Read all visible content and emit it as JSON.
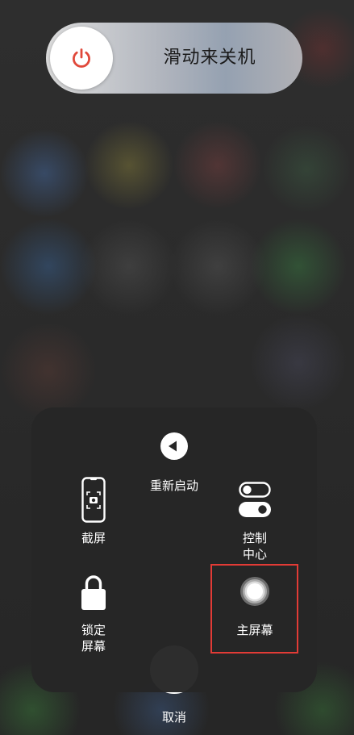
{
  "power_slider": {
    "label": "滑动来关机",
    "icon": "power-icon",
    "icon_color": "#e0483a"
  },
  "menu": {
    "restart": {
      "label": "重新启动",
      "icon": "left-arrow-circle-icon"
    },
    "screenshot": {
      "label": "截屏",
      "icon": "phone-screenshot-icon"
    },
    "control_center": {
      "label_line1": "控制",
      "label_line2": "中心",
      "icon": "toggles-icon"
    },
    "lock_screen": {
      "label_line1": "锁定",
      "label_line2": "屏幕",
      "icon": "lock-icon"
    },
    "home": {
      "label": "主屏幕",
      "icon": "home-button-icon"
    }
  },
  "cancel": {
    "label": "取消"
  },
  "highlight_color": "#e23b36"
}
